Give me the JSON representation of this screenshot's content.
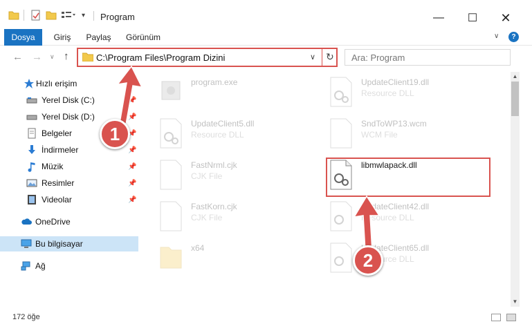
{
  "window": {
    "title": "Program",
    "minimize_icon": "minimize-icon",
    "maximize_icon": "maximize-icon",
    "close_icon": "close-icon"
  },
  "ribbon": {
    "tabs": [
      {
        "label": "Dosya",
        "active": true
      },
      {
        "label": "Giriş",
        "active": false
      },
      {
        "label": "Paylaş",
        "active": false
      },
      {
        "label": "Görünüm",
        "active": false
      }
    ],
    "help_label": "?"
  },
  "address": {
    "path": "C:\\Program Files\\Program Dizini",
    "search_placeholder": "Ara: Program"
  },
  "sidebar": {
    "items": [
      {
        "label": "Hızlı erişim",
        "icon": "star-icon"
      },
      {
        "label": "Yerel Disk (C:)",
        "icon": "drive-icon",
        "pinned": true
      },
      {
        "label": "Yerel Disk (D:)",
        "icon": "drive-icon",
        "pinned": true
      },
      {
        "label": "Belgeler",
        "icon": "documents-icon",
        "pinned": true
      },
      {
        "label": "İndirmeler",
        "icon": "download-icon",
        "pinned": true
      },
      {
        "label": "Müzik",
        "icon": "music-icon",
        "pinned": true
      },
      {
        "label": "Resimler",
        "icon": "pictures-icon",
        "pinned": true
      },
      {
        "label": "Videolar",
        "icon": "video-icon",
        "pinned": true
      },
      {
        "label": "OneDrive",
        "icon": "cloud-icon"
      },
      {
        "label": "Bu bilgisayar",
        "icon": "computer-icon",
        "selected": true
      },
      {
        "label": "Ağ",
        "icon": "network-icon"
      }
    ]
  },
  "files": [
    {
      "name": "program.exe",
      "type": "",
      "icon": "exe-icon"
    },
    {
      "name": "UpdateClient19.dll",
      "type": "Resource DLL",
      "icon": "dll-icon"
    },
    {
      "name": "UpdateClient5.dll",
      "type": "Resource DLL",
      "icon": "dll-icon"
    },
    {
      "name": "SndToWP13.wcm",
      "type": "WCM File",
      "icon": "file-icon"
    },
    {
      "name": "FastNrml.cjk",
      "type": "CJK File",
      "icon": "file-icon"
    },
    {
      "name": "libmwlapack.dll",
      "type": "",
      "icon": "dll-icon"
    },
    {
      "name": "FastKorn.cjk",
      "type": "CJK File",
      "icon": "file-icon"
    },
    {
      "name": "UpdateClient42.dll",
      "type": "Resource DLL",
      "icon": "dll-icon"
    },
    {
      "name": "x64",
      "type": "",
      "icon": "folder-icon"
    },
    {
      "name": "UpdateClient65.dll",
      "type": "Resource DLL",
      "icon": "dll-icon"
    }
  ],
  "status": {
    "item_count": "172 öğe"
  },
  "callouts": [
    {
      "number": "1"
    },
    {
      "number": "2"
    }
  ],
  "colors": {
    "accent": "#1a73c2",
    "callout": "#d9534f",
    "selected_bg": "#cce4f7"
  }
}
